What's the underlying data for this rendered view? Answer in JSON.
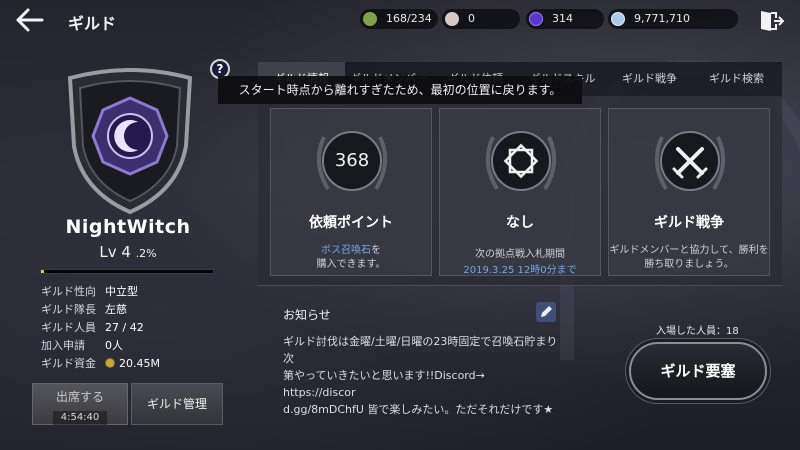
{
  "header": {
    "title": "ギルド",
    "resources": [
      {
        "icon": "guild-token-icon",
        "value": "168/234",
        "color": "#7fa34a"
      },
      {
        "icon": "pearl-icon",
        "value": "0",
        "color": "#d9c9c6"
      },
      {
        "icon": "purple-gem-icon",
        "value": "314",
        "color": "#5a36c9"
      },
      {
        "icon": "silver-coin-icon",
        "value": "9,771,710",
        "color": "#a9c8e8"
      }
    ]
  },
  "guild": {
    "name": "NightWitch",
    "level_label": "Lv 4",
    "level_pct": ".2%",
    "exp_progress": 0.02,
    "info": [
      {
        "label": "ギルド性向",
        "value": "中立型"
      },
      {
        "label": "ギルド隊長",
        "value": "左慈"
      },
      {
        "label": "ギルド人員",
        "value": "27 / 42"
      },
      {
        "label": "加入申請",
        "value": "0人"
      },
      {
        "label": "ギルド資金",
        "value": "20.45M"
      }
    ]
  },
  "buttons": {
    "attend_label": "出席する",
    "attend_timer": "4:54:40",
    "manage_label": "ギルド管理",
    "fortress_label": "ギルド要塞"
  },
  "tabs": [
    {
      "label": "ギルド情報"
    },
    {
      "label": "ギルドメンバー"
    },
    {
      "label": "ギルド依頼"
    },
    {
      "label": "ギルドスキル"
    },
    {
      "label": "ギルド戦争"
    },
    {
      "label": "ギルド検索"
    }
  ],
  "toast": "スタート時点から離れすぎたため、最初の位置に戻ります。",
  "cards": {
    "request": {
      "value": "368",
      "title": "依頼ポイント",
      "desc_highlight": "ボス召喚石",
      "desc_rest": "を",
      "desc_line2": "購入できます。"
    },
    "base": {
      "title": "なし",
      "desc": "次の拠点戦入札期間",
      "date": "2019.3.25 12時0分まで"
    },
    "war": {
      "title": "ギルド戦争",
      "desc_line1": "ギルドメンバーと協力して、勝利を",
      "desc_line2": "勝ち取りましょう。"
    }
  },
  "notice": {
    "title": "お知らせ",
    "lines": [
      "ギルド討伐は金曜/土曜/日曜の23時固定で召喚石貯まり次",
      "第やっていきたいと思います!!Discord→ https://discor",
      "d.gg/8mDChfU 皆で楽しみたい。ただそれだけです★"
    ]
  },
  "entered_members": "入場した人員：18"
}
